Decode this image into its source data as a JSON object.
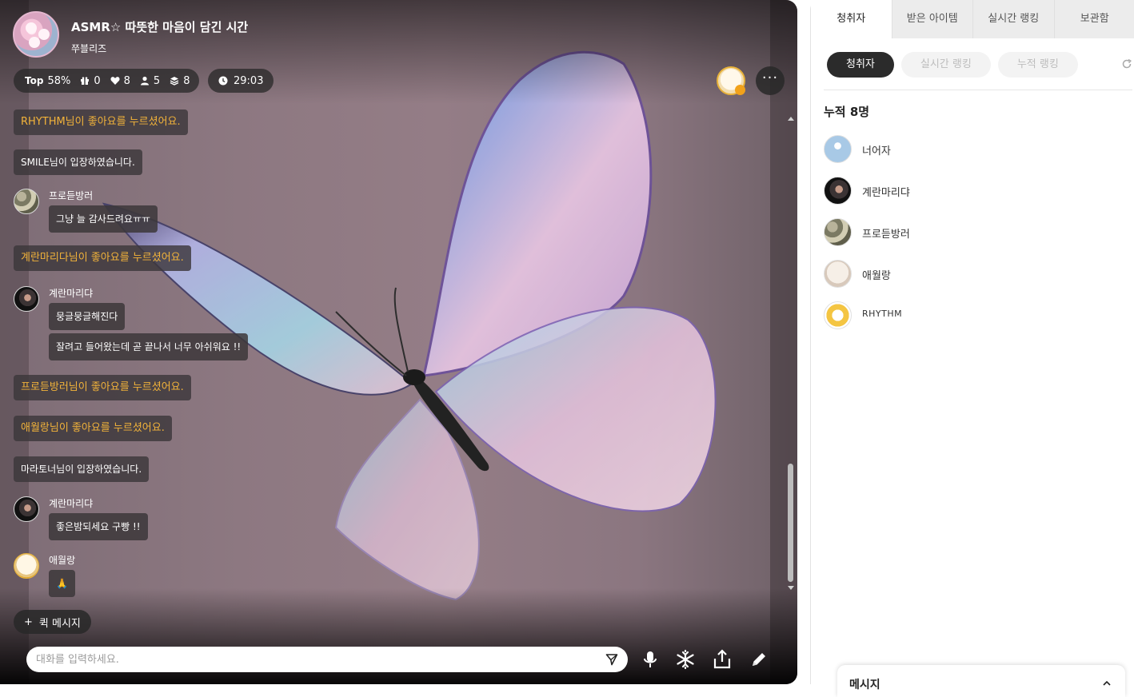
{
  "room": {
    "title": "ASMR☆ 따뜻한 마음이 담긴 시간",
    "host": "쭈블리즈",
    "stats": {
      "top_label": "Top",
      "top_value": "58%",
      "gifts": "0",
      "likes": "8",
      "listeners": "5",
      "stack": "8"
    },
    "timer": "29:03",
    "more_label": "···"
  },
  "chat": {
    "items": [
      {
        "type": "like",
        "text": "RHYTHM님이 좋아요를 누르셨어요."
      },
      {
        "type": "enter",
        "text": "SMILE님이 입장하였습니다."
      },
      {
        "type": "msg",
        "name": "프로듣방러",
        "lines": [
          "그냥 늘 감사드려요ㅠㅠ"
        ]
      },
      {
        "type": "like",
        "text": "계란마리다님이 좋아요를 누르셨어요."
      },
      {
        "type": "msg",
        "name": "계란마리댜",
        "lines": [
          "뭉글뭉글해진다",
          "잘려고 들어왔는데 곧 끝나서 너무 아쉬워요 !!"
        ]
      },
      {
        "type": "like",
        "text": "프로듣방러님이 좋아요를 누르셨어요."
      },
      {
        "type": "like",
        "text": "애월랑님이 좋아요를 누르셨어요."
      },
      {
        "type": "enter",
        "text": "마라토너님이 입장하였습니다."
      },
      {
        "type": "msg",
        "name": "계란마리댜",
        "lines": [
          "좋은밤되세요 구빵 !!"
        ]
      },
      {
        "type": "msg",
        "name": "애월랑",
        "lines": [
          "🙏"
        ]
      }
    ]
  },
  "quick_message": {
    "plus": "+",
    "label": "퀵 메시지"
  },
  "input": {
    "placeholder": "대화를 입력하세요.",
    "value": ""
  },
  "panel": {
    "tabs": [
      "청취자",
      "받은 아이템",
      "실시간 랭킹",
      "보관함"
    ],
    "subtabs": [
      "청취자",
      "실시간 랭킹",
      "누적 랭킹"
    ],
    "total": "누적 8명",
    "listeners": [
      {
        "name": "너어자"
      },
      {
        "name": "계란마리댜"
      },
      {
        "name": "프로듣방러"
      },
      {
        "name": "애월랑"
      },
      {
        "name": "RHYTHM"
      }
    ],
    "message_card": "메시지"
  },
  "colors": {
    "like_text": "#f2b33a",
    "active_pill": "#2b2b2b",
    "bubble_bg": "#3c373a"
  }
}
